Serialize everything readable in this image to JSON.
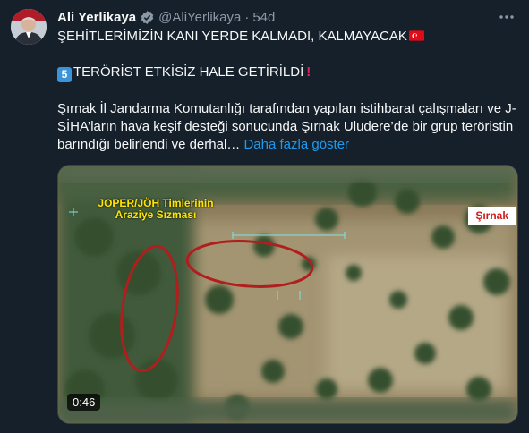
{
  "author": {
    "name": "Ali Yerlikaya",
    "handle": "@AliYerlikaya",
    "separator": "·",
    "time": "54d"
  },
  "tweet": {
    "line1": "ŞEHİTLERİMİZİN KANI YERDE KALMADI, KALMAYACAK",
    "line2_keycap": "5",
    "line2": "TERÖRİST ETKİSİZ HALE GETİRİLDİ",
    "line2_mark": "!",
    "body": "Şırnak İl Jandarma Komutanlığı tarafından yapılan istihbarat çalışmaları ve J-SİHA’ların hava keşif desteği sonucunda Şırnak Uludere’de bir grup teröristin barındığı belirlendi ve derhal…",
    "show_more": "Daha fazla göster"
  },
  "media": {
    "overlay_title": "JOPER/JÖH Timlerinin Araziye Sızması",
    "location_tag": "Şırnak",
    "duration": "0:46"
  },
  "icons": {
    "verified": "verified-badge-icon",
    "more": "more-options-icon",
    "flag": "turkey-flag-icon"
  },
  "colors": {
    "background": "#15202b",
    "link": "#1d9bf0",
    "muted": "#8b98a5",
    "overlay_yellow": "#ffe600",
    "annotation_red": "#b01e1e"
  }
}
